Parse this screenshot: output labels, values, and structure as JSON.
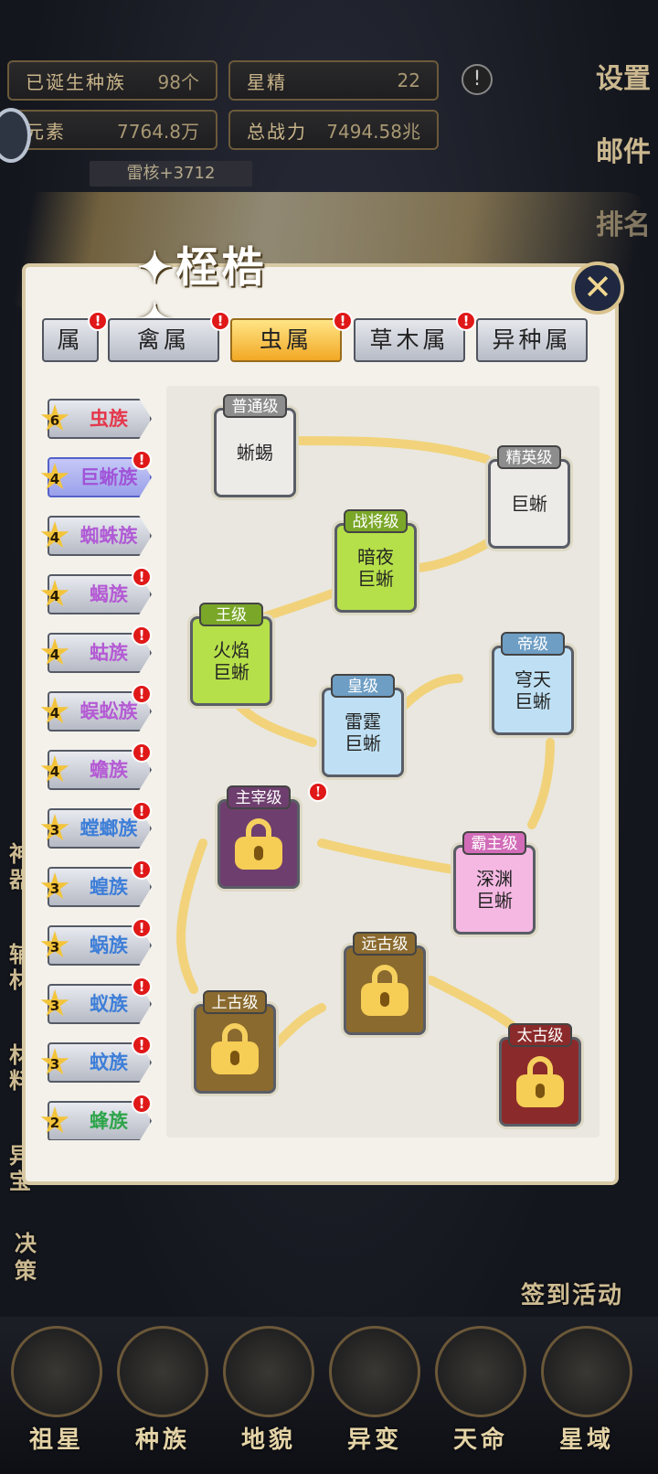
{
  "stats": {
    "born_label": "已诞生种族",
    "born_value": "98个",
    "essence_label": "星精",
    "essence_value": "22",
    "element_label": "元素",
    "element_value": "7764.8万",
    "power_label": "总战力",
    "power_value": "7494.58兆",
    "thunder_core": "雷核+3712"
  },
  "right_menu": [
    "设置",
    "邮件",
    "排名"
  ],
  "panel": {
    "title": "✦桎梏✦"
  },
  "tabs": [
    {
      "label": "属",
      "badge": "!"
    },
    {
      "label": "禽属",
      "badge": "!"
    },
    {
      "label": "虫属",
      "badge": "!",
      "active": true
    },
    {
      "label": "草木属",
      "badge": "!"
    },
    {
      "label": "异种属",
      "badge": ""
    }
  ],
  "tribes": [
    {
      "stars": "6",
      "name": "虫族",
      "color": "#e5364a",
      "badge": ""
    },
    {
      "stars": "4",
      "name": "巨蜥族",
      "color": "#a054d8",
      "badge": "!",
      "selected": true
    },
    {
      "stars": "4",
      "name": "蜘蛛族",
      "color": "#b05ad6",
      "badge": ""
    },
    {
      "stars": "4",
      "name": "蝎族",
      "color": "#b45ad4",
      "badge": "!"
    },
    {
      "stars": "4",
      "name": "蛄族",
      "color": "#b45ad4",
      "badge": "!"
    },
    {
      "stars": "4",
      "name": "蜈蚣族",
      "color": "#b45ad4",
      "badge": "!"
    },
    {
      "stars": "4",
      "name": "蟾族",
      "color": "#b45ad4",
      "badge": "!"
    },
    {
      "stars": "3",
      "name": "螳螂族",
      "color": "#3d7ed8",
      "badge": "!"
    },
    {
      "stars": "3",
      "name": "蝗族",
      "color": "#3d7ed8",
      "badge": "!"
    },
    {
      "stars": "3",
      "name": "蜗族",
      "color": "#3d7ed8",
      "badge": "!"
    },
    {
      "stars": "3",
      "name": "蚁族",
      "color": "#3d7ed8",
      "badge": "!"
    },
    {
      "stars": "3",
      "name": "蚊族",
      "color": "#3d7ed8",
      "badge": "!"
    },
    {
      "stars": "2",
      "name": "蜂族",
      "color": "#2ea44a",
      "badge": "!"
    }
  ],
  "stages": [
    {
      "tier": "普通级",
      "name": "蜥蜴",
      "locked": false,
      "bg": "#ecebe8",
      "tag_bg": "#8d8d8d"
    },
    {
      "tier": "精英级",
      "name": "巨蜥",
      "locked": false,
      "bg": "#ecebe8",
      "tag_bg": "#8d8d8d"
    },
    {
      "tier": "战将级",
      "name": "暗夜\n巨蜥",
      "locked": false,
      "bg": "#b6e04a",
      "tag_bg": "#7aa728"
    },
    {
      "tier": "王级",
      "name": "火焰\n巨蜥",
      "locked": false,
      "bg": "#b6e04a",
      "tag_bg": "#7aa728"
    },
    {
      "tier": "皇级",
      "name": "雷霆\n巨蜥",
      "locked": false,
      "bg": "#bfe0f4",
      "tag_bg": "#6e9ec4"
    },
    {
      "tier": "帝级",
      "name": "穹天\n巨蜥",
      "locked": false,
      "bg": "#bfe0f4",
      "tag_bg": "#6e9ec4"
    },
    {
      "tier": "霸主级",
      "name": "深渊\n巨蜥",
      "locked": false,
      "bg": "#f5b8e3",
      "tag_bg": "#d26cb8"
    },
    {
      "tier": "主宰级",
      "name": "",
      "locked": true,
      "bg": "#6e3f6e",
      "tag_bg": "#6e3f6e",
      "badge": "!"
    },
    {
      "tier": "远古级",
      "name": "",
      "locked": true,
      "bg": "#8a6a2e",
      "tag_bg": "#8a6a2e"
    },
    {
      "tier": "上古级",
      "name": "",
      "locked": true,
      "bg": "#8a6a2e",
      "tag_bg": "#8a6a2e"
    },
    {
      "tier": "太古级",
      "name": "",
      "locked": true,
      "bg": "#8b2a2a",
      "tag_bg": "#8b2a2a"
    }
  ],
  "side_labels": [
    "神器",
    "辅材",
    "材料",
    "异宝",
    "决策"
  ],
  "checkin": "签到活动",
  "nav": [
    "祖星",
    "种族",
    "地貌",
    "异变",
    "天命",
    "星域"
  ],
  "colors": {
    "accent": "#f2a825",
    "badge": "#e01818"
  }
}
